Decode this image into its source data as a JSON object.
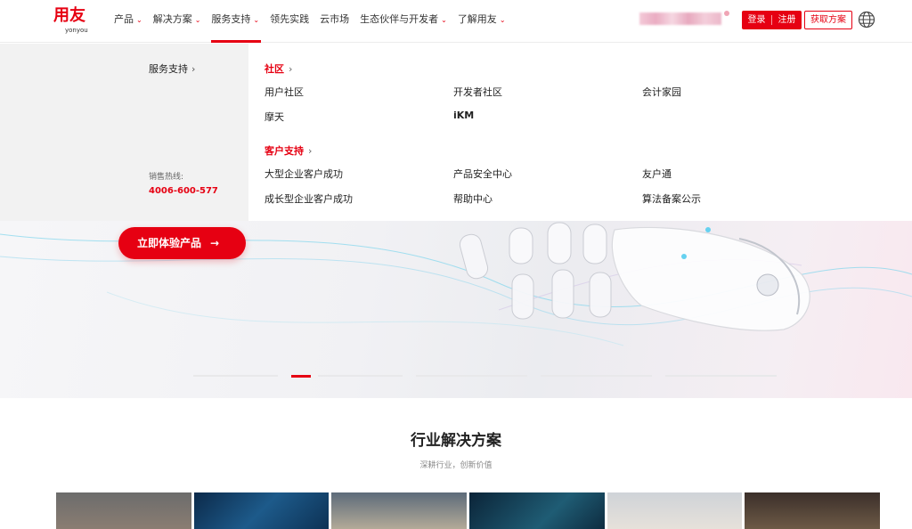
{
  "brand": {
    "name_cn": "用友",
    "name_en": "yonyou",
    "accent": "#e60012"
  },
  "nav": [
    {
      "label": "产品",
      "has_dropdown": true,
      "active": false
    },
    {
      "label": "解决方案",
      "has_dropdown": true,
      "active": false
    },
    {
      "label": "服务支持",
      "has_dropdown": true,
      "active": true
    },
    {
      "label": "领先实践",
      "has_dropdown": false,
      "active": false
    },
    {
      "label": "云市场",
      "has_dropdown": false,
      "active": false
    },
    {
      "label": "生态伙伴与开发者",
      "has_dropdown": true,
      "active": false
    },
    {
      "label": "了解用友",
      "has_dropdown": true,
      "active": false
    }
  ],
  "header_actions": {
    "login": "登录",
    "register": "注册",
    "get_plan": "获取方案",
    "language_icon": "globe-icon"
  },
  "dropdown": {
    "side_title": "服务支持",
    "hotline_label": "销售热线:",
    "hotline_number": "4006-600-577",
    "categories": [
      {
        "title": "社区",
        "links": [
          "用户社区",
          "开发者社区",
          "会计家园",
          "摩天",
          "iKM"
        ]
      },
      {
        "title": "客户支持",
        "links": [
          "大型企业客户成功",
          "产品安全中心",
          "友户通",
          "成长型企业客户成功",
          "帮助中心",
          "算法备案公示"
        ]
      }
    ]
  },
  "hero": {
    "cta_label": "立即体验产品",
    "cta_arrow": "→",
    "active_slide_index": 1
  },
  "section": {
    "title": "行业解决方案",
    "subtitle": "深耕行业，创新价值"
  }
}
